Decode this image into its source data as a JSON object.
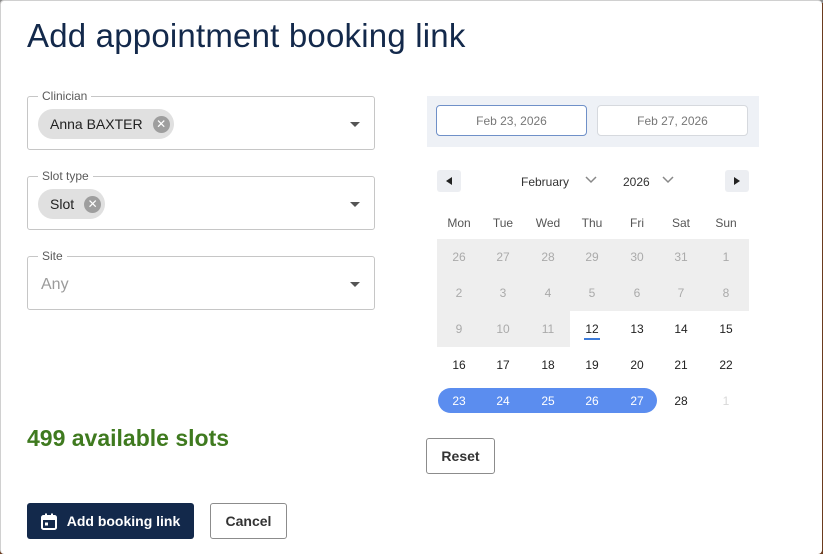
{
  "dialog": {
    "title": "Add appointment booking link"
  },
  "clinician": {
    "label": "Clinician",
    "chip": "Anna BAXTER"
  },
  "slot_type": {
    "label": "Slot type",
    "chip": "Slot"
  },
  "site": {
    "label": "Site",
    "placeholder": "Any"
  },
  "available": {
    "text": "499 available slots"
  },
  "buttons": {
    "add": "Add booking link",
    "cancel": "Cancel",
    "reset": "Reset"
  },
  "range": {
    "start": "Feb 23, 2026",
    "end": "Feb 27, 2026"
  },
  "calendar": {
    "month": "February",
    "year": "2026",
    "weekdays": [
      "Mon",
      "Tue",
      "Wed",
      "Thu",
      "Fri",
      "Sat",
      "Sun"
    ],
    "weeks": [
      [
        "26",
        "27",
        "28",
        "29",
        "30",
        "31",
        "1"
      ],
      [
        "2",
        "3",
        "4",
        "5",
        "6",
        "7",
        "8"
      ],
      [
        "9",
        "10",
        "11",
        "12",
        "13",
        "14",
        "15"
      ],
      [
        "16",
        "17",
        "18",
        "19",
        "20",
        "21",
        "22"
      ],
      [
        "23",
        "24",
        "25",
        "26",
        "27",
        "28",
        "1"
      ]
    ]
  },
  "colors": {
    "primary": "#13294b",
    "success": "#3f7a1f",
    "selection": "#5b8def",
    "today_underline": "#3d7bd9"
  }
}
